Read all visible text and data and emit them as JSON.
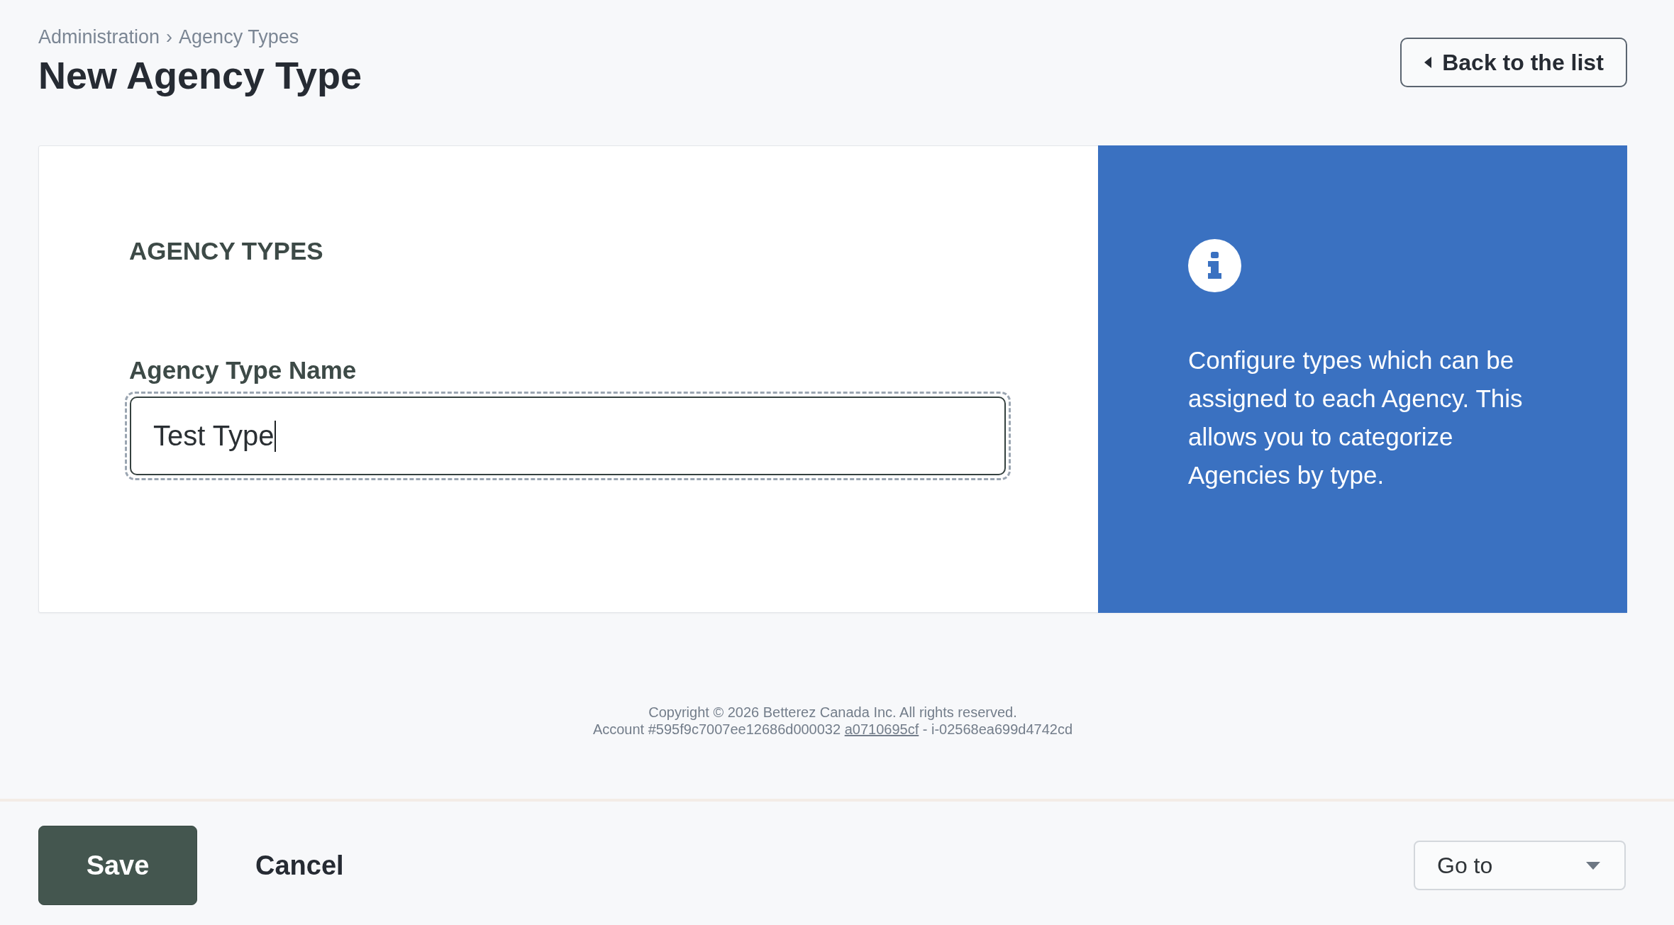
{
  "breadcrumb": {
    "items": [
      {
        "label": "Administration"
      },
      {
        "label": "Agency Types"
      }
    ],
    "separator": "›"
  },
  "page_title": "New Agency Type",
  "back_button": {
    "label": "Back to the list"
  },
  "form": {
    "section_title": "AGENCY TYPES",
    "fields": [
      {
        "label": "Agency Type Name",
        "value": "Test Type",
        "focused": true
      }
    ]
  },
  "info_panel": {
    "text": "Configure types which can be assigned to each Agency. This allows you to categorize Agencies by type."
  },
  "footer": {
    "copyright": "Copyright © 2026 Betterez Canada Inc. All rights reserved.",
    "account": {
      "prefix": "Account #595f9c7007ee12686d000032",
      "link": "a0710695cf",
      "suffix": "- i-02568ea699d4742cd"
    }
  },
  "action_bar": {
    "buttons": [
      {
        "label": "Save",
        "kind": "primary"
      },
      {
        "label": "Cancel",
        "kind": "link"
      }
    ],
    "goto": {
      "value": "Go to"
    }
  }
}
